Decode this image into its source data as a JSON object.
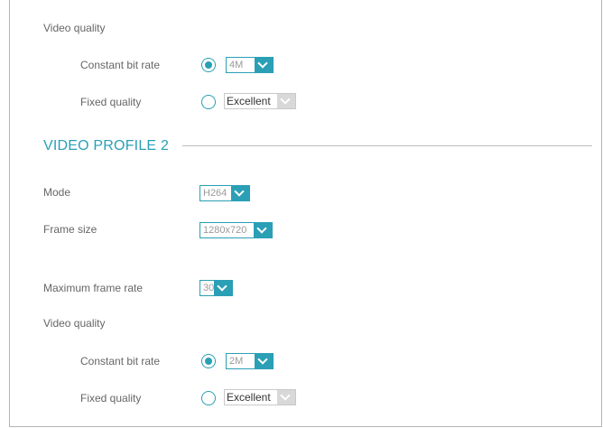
{
  "profile1": {
    "video_quality_label": "Video quality",
    "constant_bit_rate_label": "Constant bit rate",
    "constant_bit_rate_selected": true,
    "bit_rate_value": "4M",
    "fixed_quality_label": "Fixed quality",
    "fixed_quality_selected": false,
    "fixed_quality_value": "Excellent"
  },
  "profile2": {
    "title": "VIDEO PROFILE 2",
    "mode_label": "Mode",
    "mode_value": "H264",
    "frame_size_label": "Frame size",
    "frame_size_value": "1280x720",
    "max_frame_rate_label": "Maximum frame rate",
    "max_frame_rate_value": "30",
    "video_quality_label": "Video quality",
    "constant_bit_rate_label": "Constant bit rate",
    "constant_bit_rate_selected": true,
    "bit_rate_value": "2M",
    "fixed_quality_label": "Fixed quality",
    "fixed_quality_selected": false,
    "fixed_quality_value": "Excellent"
  },
  "colors": {
    "accent": "#2a9fb5",
    "label_text": "#666666",
    "disabled_arrow": "#d8d8d8"
  },
  "icons": {
    "select_arrow": "chevron-down-icon"
  }
}
